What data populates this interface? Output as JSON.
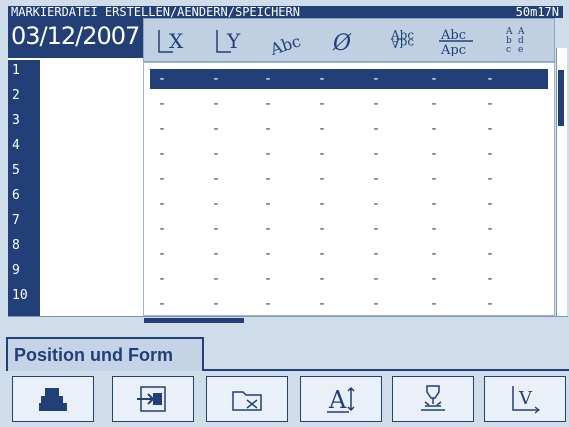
{
  "window": {
    "title": "MARKIERDATEI  ERSTELLEN/AENDERN/SPEICHERN",
    "status": "50m17N",
    "date": "03/12/2007"
  },
  "toolbar": {
    "icons": [
      "x-position-icon",
      "y-position-icon",
      "text-arc-icon",
      "diameter-icon",
      "text-angle-icon",
      "mirror-text-icon",
      "char-direction-icon"
    ],
    "labels": [
      "X",
      "Y",
      "Abc",
      "Ø",
      "Abc",
      "Abc",
      "abc"
    ]
  },
  "rows": {
    "numbers": [
      "1",
      "2",
      "3",
      "4",
      "5",
      "6",
      "7",
      "8",
      "9",
      "10"
    ],
    "placeholder": "-",
    "selected_row": 1
  },
  "tab": {
    "label": "Position und Form"
  },
  "bottom": {
    "buttons": [
      "hammer-icon",
      "import-icon",
      "folder-icon",
      "text-height-icon",
      "marking-icon",
      "xy-axis-icon"
    ]
  },
  "colors": {
    "navy": "#233f77",
    "background": "#cfdce9",
    "toolbar": "#bfd0e3"
  }
}
